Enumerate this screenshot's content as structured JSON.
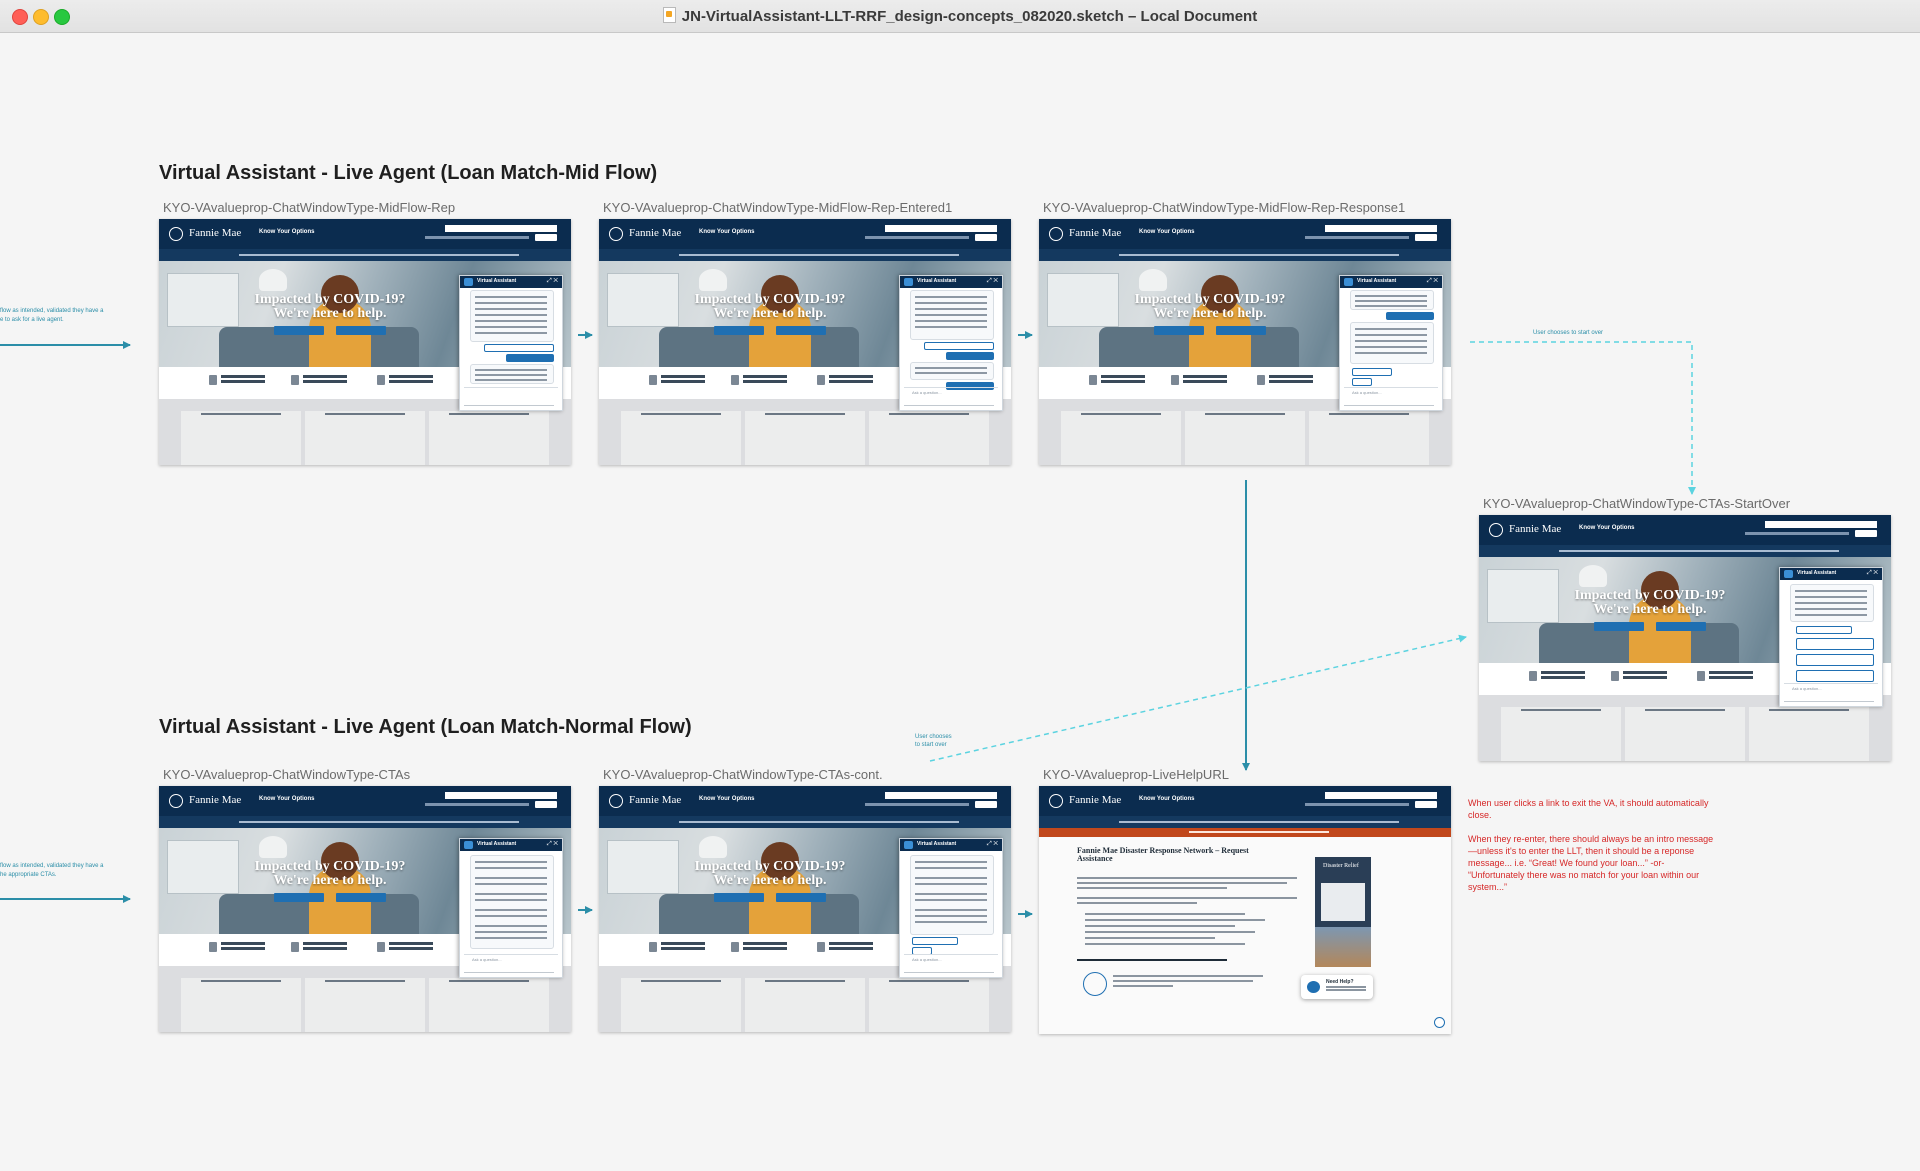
{
  "window": {
    "title": "JN-VirtualAssistant-LLT-RRF_design-concepts_082020.sketch – Local Document"
  },
  "sections": [
    {
      "id": "mid",
      "title": "Virtual Assistant - Live Agent (Loan Match-Mid Flow)"
    },
    {
      "id": "normal",
      "title": "Virtual Assistant - Live Agent (Loan Match-Normal Flow)"
    }
  ],
  "artboards": [
    {
      "label": "KYO-VAvalueprop-ChatWindowType-MidFlow-Rep"
    },
    {
      "label": "KYO-VAvalueprop-ChatWindowType-MidFlow-Rep-Entered1"
    },
    {
      "label": "KYO-VAvalueprop-ChatWindowType-MidFlow-Rep-Response1"
    },
    {
      "label": "KYO-VAvalueprop-ChatWindowType-CTAs-StartOver"
    },
    {
      "label": "KYO-VAvalueprop-ChatWindowType-CTAs"
    },
    {
      "label": "KYO-VAvalueprop-ChatWindowType-CTAs-cont."
    },
    {
      "label": "KYO-VAvalueprop-LiveHelpURL"
    }
  ],
  "site": {
    "brand": "Fannie Mae",
    "nav_title": "Know Your Options",
    "hero_heading": "Impacted by COVID-19? We're here to help.",
    "chat_title": "Virtual Assistant",
    "chat_input_placeholder": "Ask a question...",
    "chat_controls": "⤢ ✕",
    "live_help_title": "Fannie Mae Disaster Response Network – Request Assistance",
    "live_help_aside": "Disaster Relief",
    "need_help": "Need Help?"
  },
  "notes": {
    "left_top": [
      "flow as intended, validated they have a",
      "e to ask for a live agent."
    ],
    "left_bottom": [
      "flow as intended, validated they have a",
      "he appropriate CTAs."
    ],
    "start_over_top": "User chooses to start over",
    "start_over_bottom": [
      "User chooses",
      "to start over"
    ],
    "exit_va": [
      "When user clicks a link to exit the VA, it should automatically close.",
      "When they re-enter, there should always be an intro message—unless it's to enter the LLT, then it should be a reponse message... i.e. “Great! We found your loan...” -or- “Unfortunately there was no match for your loan within our system...”"
    ]
  },
  "colors": {
    "brand_navy": "#0b2c4f",
    "connector_teal": "#2b8ea8",
    "connector_cyan": "#5bd3e0",
    "note_red": "#d62828",
    "live_help_orange": "#c1481c"
  }
}
